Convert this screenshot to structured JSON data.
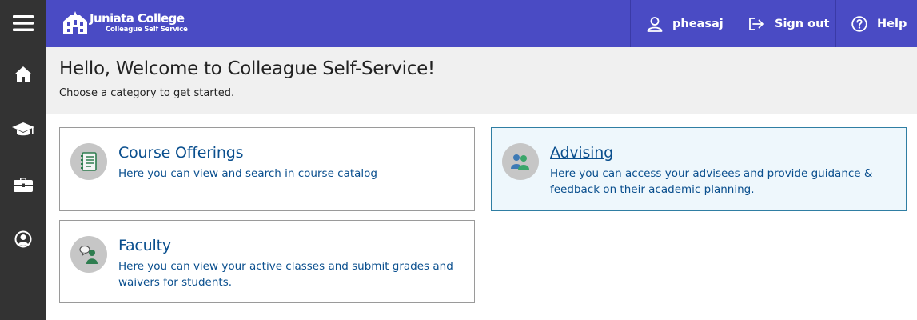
{
  "brand": {
    "title": "Juniata College",
    "subtitle": "Colleague Self Service"
  },
  "sidebar": {
    "items": [
      {
        "name": "menu",
        "icon": "hamburger-menu-icon"
      },
      {
        "name": "home",
        "icon": "home-icon"
      },
      {
        "name": "academics",
        "icon": "graduation-cap-icon"
      },
      {
        "name": "employment",
        "icon": "briefcase-icon"
      },
      {
        "name": "profile",
        "icon": "user-circle-icon"
      }
    ]
  },
  "header": {
    "user": "pheasaj",
    "signout": "Sign out",
    "help": "Help"
  },
  "welcome": {
    "title": "Hello, Welcome to Colleague Self-Service!",
    "subtitle": "Choose a category to get started."
  },
  "categories": [
    {
      "title": "Course Offerings",
      "description": "Here you can view and search in course catalog",
      "icon": "catalog-book-icon"
    },
    {
      "title": "Advising",
      "description": "Here you can access your advisees and provide guidance & feedback on their academic planning.",
      "icon": "advising-people-icon"
    },
    {
      "title": "Faculty",
      "description": "Here you can view your active classes and submit grades and waivers for students.",
      "icon": "faculty-teacher-icon"
    }
  ],
  "colors": {
    "header": "#4a4bc4",
    "sidebar": "#333333",
    "link": "#0a4f8e",
    "active_card_bg": "#eef7fc",
    "active_card_border": "#2f7ea3"
  }
}
